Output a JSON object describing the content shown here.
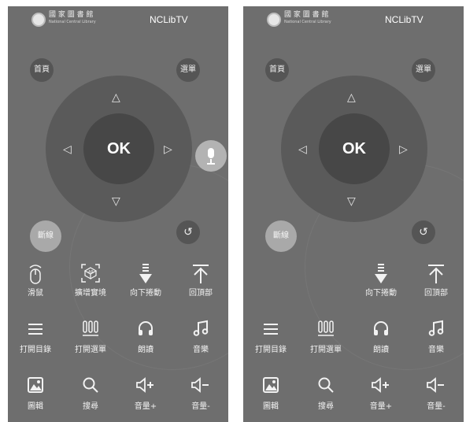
{
  "header": {
    "logo_text": "國 家 圖 書 館",
    "logo_subtext": "National Central Library",
    "app_title": "NCLibTV"
  },
  "buttons": {
    "home": "首頁",
    "menu": "選單",
    "ok": "OK",
    "disconnect": "斷線",
    "back": "↺"
  },
  "arrows": {
    "up": "△",
    "down": "▽",
    "left": "◁",
    "right": "▷"
  },
  "controls_left": [
    {
      "label": "滑鼠",
      "icon": "mouse-icon"
    },
    {
      "label": "擴增實境",
      "icon": "ar-icon"
    },
    {
      "label": "向下捲動",
      "icon": "scroll-down-icon"
    },
    {
      "label": "回頂部",
      "icon": "back-to-top-icon"
    },
    {
      "label": "打開目錄",
      "icon": "list-icon"
    },
    {
      "label": "打開選單",
      "icon": "menu-bars-icon"
    },
    {
      "label": "朗讀",
      "icon": "headphones-icon"
    },
    {
      "label": "音樂",
      "icon": "music-note-icon"
    },
    {
      "label": "圖輯",
      "icon": "image-icon"
    },
    {
      "label": "搜尋",
      "icon": "search-icon"
    },
    {
      "label": "音量+",
      "icon": "volume-up-icon"
    },
    {
      "label": "音量-",
      "icon": "volume-down-icon"
    }
  ],
  "controls_right": [
    {
      "label": "向下捲動",
      "icon": "scroll-down-icon"
    },
    {
      "label": "回頂部",
      "icon": "back-to-top-icon"
    },
    {
      "label": "打開目錄",
      "icon": "list-icon"
    },
    {
      "label": "打開選單",
      "icon": "menu-bars-icon"
    },
    {
      "label": "朗讀",
      "icon": "headphones-icon"
    },
    {
      "label": "音樂",
      "icon": "music-note-icon"
    },
    {
      "label": "圖輯",
      "icon": "image-icon"
    },
    {
      "label": "搜尋",
      "icon": "search-icon"
    },
    {
      "label": "音量+",
      "icon": "volume-up-icon"
    },
    {
      "label": "音量-",
      "icon": "volume-down-icon"
    }
  ]
}
